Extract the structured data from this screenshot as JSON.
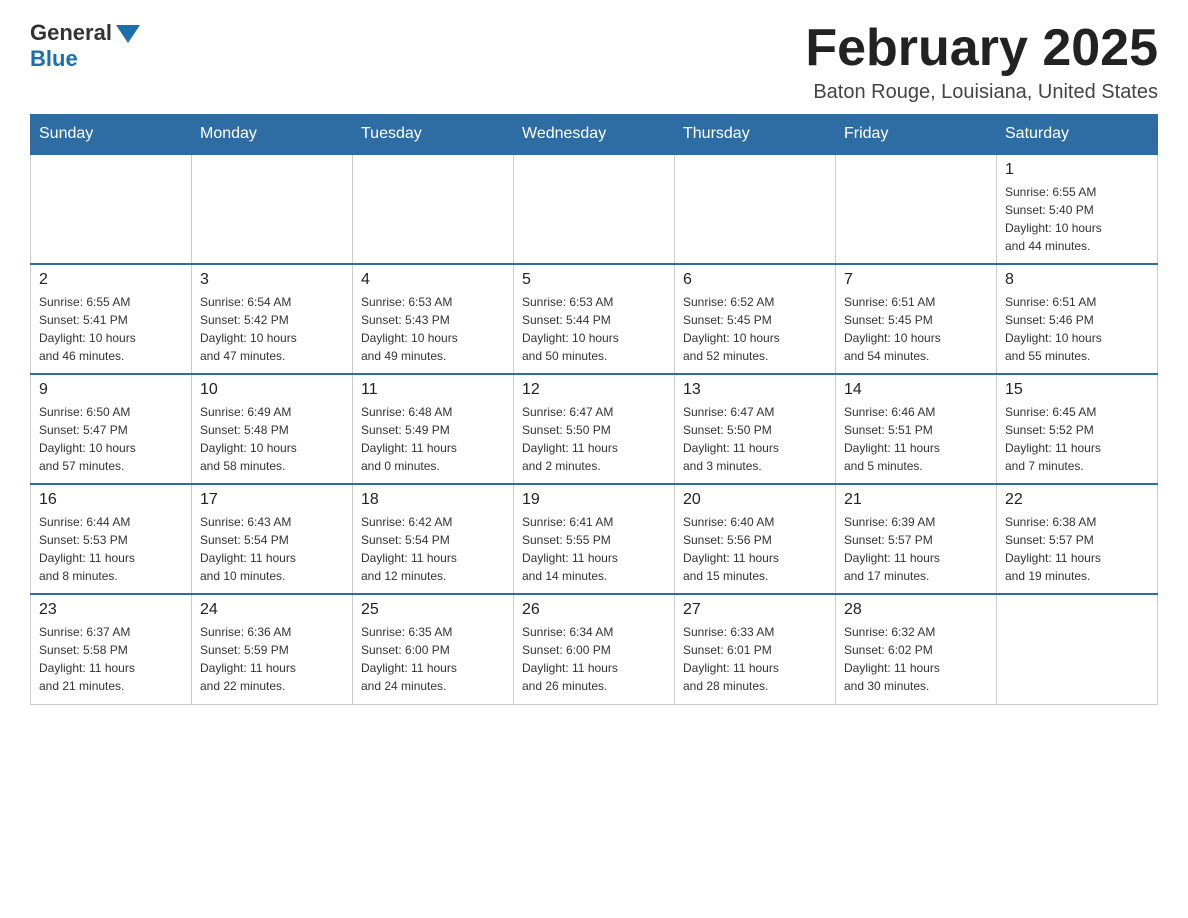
{
  "header": {
    "logo_general": "General",
    "logo_blue": "Blue",
    "main_title": "February 2025",
    "subtitle": "Baton Rouge, Louisiana, United States"
  },
  "calendar": {
    "weekdays": [
      "Sunday",
      "Monday",
      "Tuesday",
      "Wednesday",
      "Thursday",
      "Friday",
      "Saturday"
    ],
    "weeks": [
      [
        {
          "day": "",
          "info": ""
        },
        {
          "day": "",
          "info": ""
        },
        {
          "day": "",
          "info": ""
        },
        {
          "day": "",
          "info": ""
        },
        {
          "day": "",
          "info": ""
        },
        {
          "day": "",
          "info": ""
        },
        {
          "day": "1",
          "info": "Sunrise: 6:55 AM\nSunset: 5:40 PM\nDaylight: 10 hours\nand 44 minutes."
        }
      ],
      [
        {
          "day": "2",
          "info": "Sunrise: 6:55 AM\nSunset: 5:41 PM\nDaylight: 10 hours\nand 46 minutes."
        },
        {
          "day": "3",
          "info": "Sunrise: 6:54 AM\nSunset: 5:42 PM\nDaylight: 10 hours\nand 47 minutes."
        },
        {
          "day": "4",
          "info": "Sunrise: 6:53 AM\nSunset: 5:43 PM\nDaylight: 10 hours\nand 49 minutes."
        },
        {
          "day": "5",
          "info": "Sunrise: 6:53 AM\nSunset: 5:44 PM\nDaylight: 10 hours\nand 50 minutes."
        },
        {
          "day": "6",
          "info": "Sunrise: 6:52 AM\nSunset: 5:45 PM\nDaylight: 10 hours\nand 52 minutes."
        },
        {
          "day": "7",
          "info": "Sunrise: 6:51 AM\nSunset: 5:45 PM\nDaylight: 10 hours\nand 54 minutes."
        },
        {
          "day": "8",
          "info": "Sunrise: 6:51 AM\nSunset: 5:46 PM\nDaylight: 10 hours\nand 55 minutes."
        }
      ],
      [
        {
          "day": "9",
          "info": "Sunrise: 6:50 AM\nSunset: 5:47 PM\nDaylight: 10 hours\nand 57 minutes."
        },
        {
          "day": "10",
          "info": "Sunrise: 6:49 AM\nSunset: 5:48 PM\nDaylight: 10 hours\nand 58 minutes."
        },
        {
          "day": "11",
          "info": "Sunrise: 6:48 AM\nSunset: 5:49 PM\nDaylight: 11 hours\nand 0 minutes."
        },
        {
          "day": "12",
          "info": "Sunrise: 6:47 AM\nSunset: 5:50 PM\nDaylight: 11 hours\nand 2 minutes."
        },
        {
          "day": "13",
          "info": "Sunrise: 6:47 AM\nSunset: 5:50 PM\nDaylight: 11 hours\nand 3 minutes."
        },
        {
          "day": "14",
          "info": "Sunrise: 6:46 AM\nSunset: 5:51 PM\nDaylight: 11 hours\nand 5 minutes."
        },
        {
          "day": "15",
          "info": "Sunrise: 6:45 AM\nSunset: 5:52 PM\nDaylight: 11 hours\nand 7 minutes."
        }
      ],
      [
        {
          "day": "16",
          "info": "Sunrise: 6:44 AM\nSunset: 5:53 PM\nDaylight: 11 hours\nand 8 minutes."
        },
        {
          "day": "17",
          "info": "Sunrise: 6:43 AM\nSunset: 5:54 PM\nDaylight: 11 hours\nand 10 minutes."
        },
        {
          "day": "18",
          "info": "Sunrise: 6:42 AM\nSunset: 5:54 PM\nDaylight: 11 hours\nand 12 minutes."
        },
        {
          "day": "19",
          "info": "Sunrise: 6:41 AM\nSunset: 5:55 PM\nDaylight: 11 hours\nand 14 minutes."
        },
        {
          "day": "20",
          "info": "Sunrise: 6:40 AM\nSunset: 5:56 PM\nDaylight: 11 hours\nand 15 minutes."
        },
        {
          "day": "21",
          "info": "Sunrise: 6:39 AM\nSunset: 5:57 PM\nDaylight: 11 hours\nand 17 minutes."
        },
        {
          "day": "22",
          "info": "Sunrise: 6:38 AM\nSunset: 5:57 PM\nDaylight: 11 hours\nand 19 minutes."
        }
      ],
      [
        {
          "day": "23",
          "info": "Sunrise: 6:37 AM\nSunset: 5:58 PM\nDaylight: 11 hours\nand 21 minutes."
        },
        {
          "day": "24",
          "info": "Sunrise: 6:36 AM\nSunset: 5:59 PM\nDaylight: 11 hours\nand 22 minutes."
        },
        {
          "day": "25",
          "info": "Sunrise: 6:35 AM\nSunset: 6:00 PM\nDaylight: 11 hours\nand 24 minutes."
        },
        {
          "day": "26",
          "info": "Sunrise: 6:34 AM\nSunset: 6:00 PM\nDaylight: 11 hours\nand 26 minutes."
        },
        {
          "day": "27",
          "info": "Sunrise: 6:33 AM\nSunset: 6:01 PM\nDaylight: 11 hours\nand 28 minutes."
        },
        {
          "day": "28",
          "info": "Sunrise: 6:32 AM\nSunset: 6:02 PM\nDaylight: 11 hours\nand 30 minutes."
        },
        {
          "day": "",
          "info": ""
        }
      ]
    ]
  }
}
